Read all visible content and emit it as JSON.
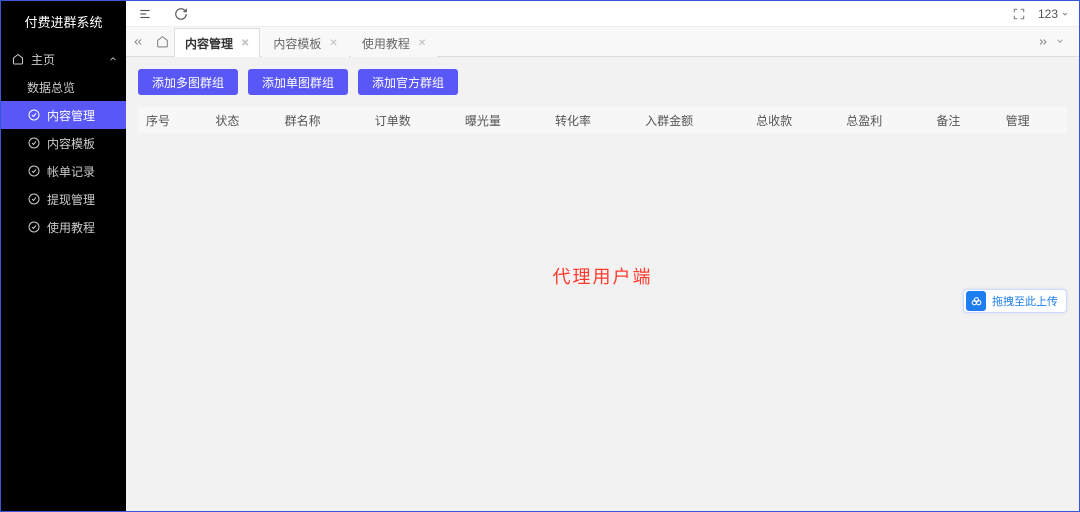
{
  "app": {
    "title": "付费进群系统"
  },
  "sidebar": {
    "home_label": "主页",
    "items": [
      {
        "label": "数据总览",
        "active": false
      },
      {
        "label": "内容管理",
        "active": true
      },
      {
        "label": "内容模板",
        "active": false
      },
      {
        "label": "帐单记录",
        "active": false
      },
      {
        "label": "提现管理",
        "active": false
      },
      {
        "label": "使用教程",
        "active": false
      }
    ]
  },
  "topbar": {
    "user_label": "123"
  },
  "tabs": [
    {
      "label": "内容管理",
      "active": true
    },
    {
      "label": "内容模板",
      "active": false
    },
    {
      "label": "使用教程",
      "active": false
    }
  ],
  "buttons": {
    "add_multi": "添加多图群组",
    "add_single": "添加单图群组",
    "add_official": "添加官方群组"
  },
  "table": {
    "headers": [
      "序号",
      "状态",
      "群名称",
      "订单数",
      "曝光量",
      "转化率",
      "入群金额",
      "总收款",
      "总盈利",
      "备注",
      "管理"
    ]
  },
  "watermark": "代理用户端",
  "upload_tip": "拖拽至此上传"
}
